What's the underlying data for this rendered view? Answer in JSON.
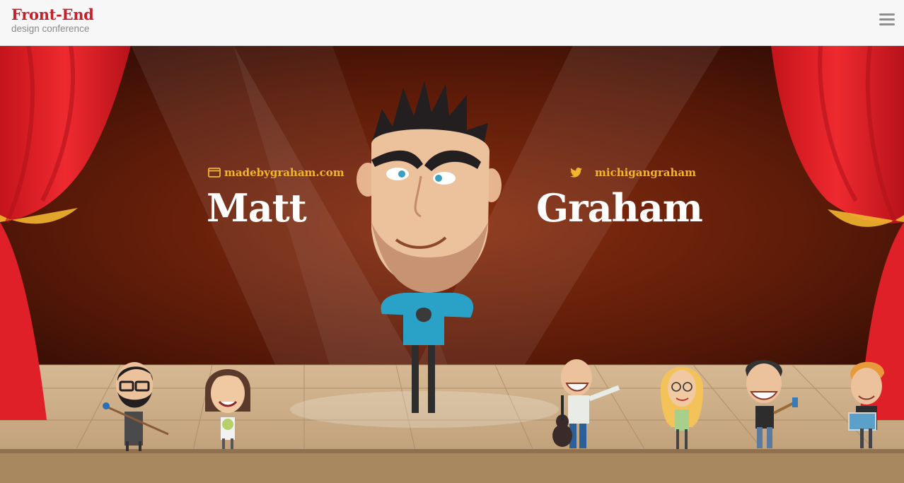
{
  "brand": {
    "title": "Front-End",
    "subtitle": "design conference"
  },
  "header": {
    "menu_icon": "hamburger-menu-icon"
  },
  "speaker": {
    "first_name": "Matt",
    "last_name": "Graham",
    "website": "madebygraham.com",
    "website_icon": "browser-window-icon",
    "twitter": "michigangraham",
    "twitter_icon": "twitter-bird-icon"
  },
  "colors": {
    "brand_red": "#c8202a",
    "link_gold": "#f2b52d",
    "curtain_red": "#e61f26",
    "stage_floor": "#c9ab86"
  }
}
